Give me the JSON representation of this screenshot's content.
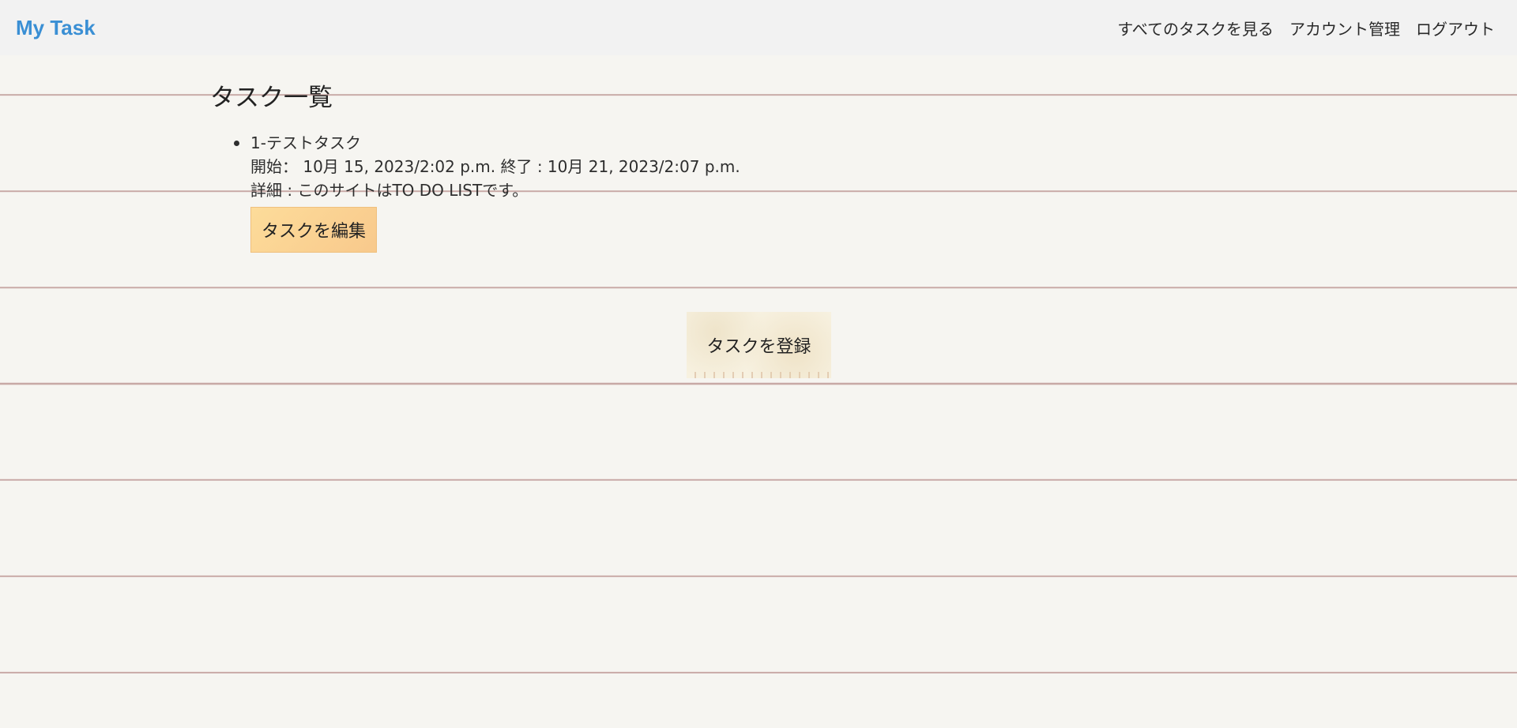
{
  "header": {
    "brand": "My Task",
    "nav": {
      "all_tasks": "すべてのタスクを見る",
      "account": "アカウント管理",
      "logout": "ログアウト"
    }
  },
  "main": {
    "title": "タスク一覧",
    "tasks": [
      {
        "name": "1-テストタスク",
        "schedule": "開始： 10月 15, 2023/2:02 p.m. 終了 : 10月 21, 2023/2:07 p.m.",
        "detail": "詳細 : このサイトはTO DO LISTです。",
        "edit_label": "タスクを編集"
      }
    ],
    "register_label": "タスクを登録"
  },
  "colors": {
    "brand": "#3a8fd4",
    "navbar_bg": "#f2f2f2",
    "page_bg": "#f6f5f1",
    "ruled_line": "#c8a9a6",
    "edit_button": "#fcd191"
  }
}
